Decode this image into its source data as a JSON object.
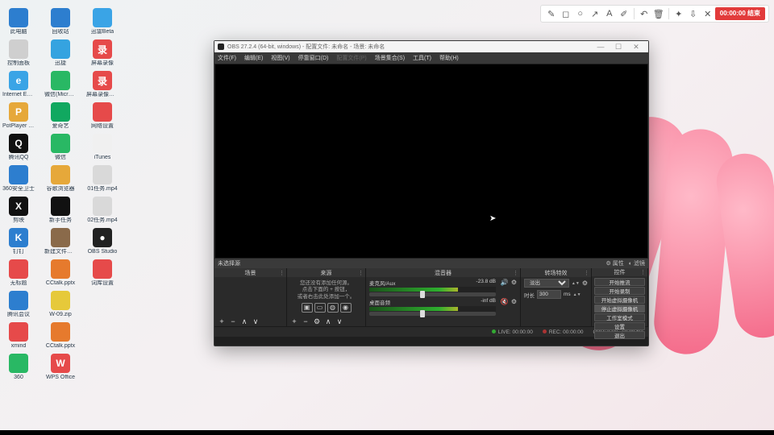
{
  "topbar": {
    "rec": "00:00:00 结束"
  },
  "desktop_icons": [
    [
      {
        "l": "此电脑",
        "c": "#2d7ecf"
      },
      {
        "l": "回收站",
        "c": "#2d7ecf"
      },
      {
        "l": "迅雷Beta",
        "c": "#3aa4e6"
      }
    ],
    [
      {
        "l": "控制面板",
        "c": "#cfcfcf"
      },
      {
        "l": "迅捷",
        "c": "#35a3e0"
      },
      {
        "l": "屏幕录像",
        "c": "#e64a4a",
        "t": "录"
      }
    ],
    [
      {
        "l": "Internet Explorer",
        "c": "#3aa4e6",
        "t": "e"
      },
      {
        "l": "微信(Microsoft)",
        "c": "#29b864"
      },
      {
        "l": "屏幕录像专家",
        "c": "#e64a4a",
        "t": "录"
      }
    ],
    [
      {
        "l": "PotPlayer 64",
        "c": "#e6a83a",
        "t": "P"
      },
      {
        "l": "爱奇艺",
        "c": "#11a860"
      },
      {
        "l": "网络设置",
        "c": "#e64a4a"
      }
    ],
    [
      {
        "l": "腾讯QQ",
        "c": "#111",
        "t": "Q"
      },
      {
        "l": "微信",
        "c": "#29b864"
      },
      {
        "l": "iTunes",
        "c": "#f0f0f0"
      }
    ],
    [
      {
        "l": "360安全卫士",
        "c": "#2d7ecf"
      },
      {
        "l": "谷歌浏览器",
        "c": "#e6a83a"
      },
      {
        "l": "01任务.mp4",
        "c": "#d9d9d9"
      }
    ],
    [
      {
        "l": "剪映",
        "c": "#111",
        "t": "X"
      },
      {
        "l": "新手任务",
        "c": "#111"
      },
      {
        "l": "02任务.mp4",
        "c": "#d9d9d9"
      }
    ],
    [
      {
        "l": "钉钉",
        "c": "#2d7ecf",
        "t": "K"
      },
      {
        "l": "新建文件夹.jpg",
        "c": "#8a6a4a"
      },
      {
        "l": "OBS Studio",
        "c": "#222",
        "t": "●"
      }
    ],
    [
      {
        "l": "无标题",
        "c": "#e64a4a"
      },
      {
        "l": "CCtalk.pptx",
        "c": "#e67a2d"
      },
      {
        "l": "词库设置",
        "c": "#e64a4a"
      }
    ],
    [
      {
        "l": "腾讯会议",
        "c": "#2d7ecf"
      },
      {
        "l": "W-09.zip",
        "c": "#e6c93a"
      }
    ],
    [
      {
        "l": "xmind",
        "c": "#e64a4a"
      },
      {
        "l": "CCtalk.pptx",
        "c": "#e67a2d"
      }
    ],
    [
      {
        "l": "360",
        "c": "#29b864"
      },
      {
        "l": "WPS Office",
        "c": "#e64a4a",
        "t": "W"
      }
    ]
  ],
  "obs": {
    "title": "OBS 27.2.4 (64-bit, windows) - 配置文件: 未命名 - 场景: 未命名",
    "menus": [
      "文件(F)",
      "编辑(E)",
      "视图(V)",
      "停靠窗口(D)",
      "配置文件(P)",
      "场景集合(S)",
      "工具(T)",
      "帮助(H)"
    ],
    "no_source": "未选择源",
    "props": "属性",
    "filters": "滤镜",
    "panels": {
      "scenes": "场景",
      "sources": "来源",
      "mixer": "混音器",
      "trans": "转场特效",
      "controls": "控件"
    },
    "sources_hint": [
      "您还没有添加任何源。",
      "点击下面的 + 按钮，",
      "或者右击此处添加一个。"
    ],
    "mixer": [
      {
        "name": "麦克风/Aux",
        "db": "-23.8 dB",
        "muted": false
      },
      {
        "name": "桌面音频",
        "db": "-inf dB",
        "muted": true
      }
    ],
    "trans": {
      "sel": "淡出",
      "dur_label": "时长",
      "dur": "300",
      "unit": "ms"
    },
    "controls": [
      "开始推流",
      "开始录制",
      "开始虚拟摄像机",
      "停止虚拟摄像机",
      "工作室模式",
      "设置",
      "退出"
    ],
    "status": {
      "live": "LIVE: 00:00:00",
      "rec": "REC: 00:00:00",
      "cpu": "CPU: 2.6%, 60.00 fps"
    }
  }
}
